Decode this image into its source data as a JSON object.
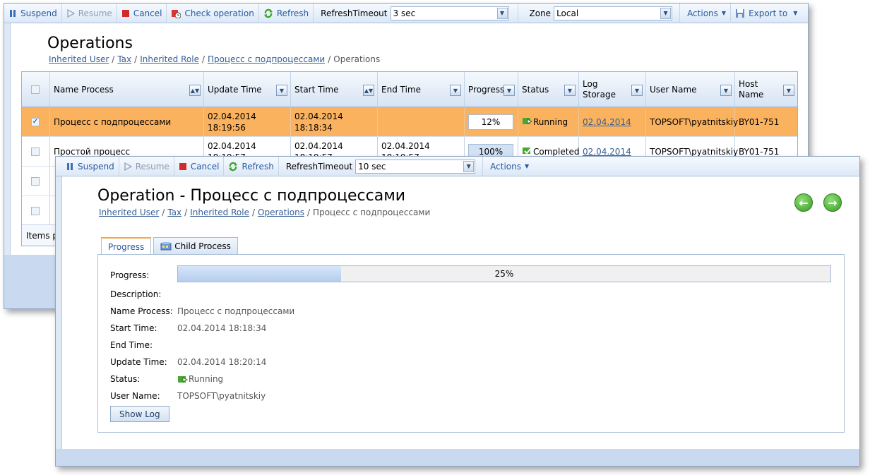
{
  "back_window": {
    "toolbar": {
      "suspend": "Suspend",
      "resume": "Resume",
      "cancel": "Cancel",
      "check_operation": "Check operation",
      "refresh": "Refresh",
      "refresh_timeout_label": "RefreshTimeout",
      "refresh_timeout_value": "3 sec",
      "zone_label": "Zone",
      "zone_value": "Local",
      "actions": "Actions",
      "export_to": "Export to"
    },
    "title": "Operations",
    "breadcrumb": [
      "Inherited User",
      "Tax",
      "Inherited Role",
      "Процесс с подпроцессами"
    ],
    "breadcrumb_current": "Operations",
    "columns": {
      "name": "Name Process",
      "update": "Update Time",
      "start": "Start Time",
      "end": "End Time",
      "progress": "Progress",
      "status": "Status",
      "log_storage_1": "Log",
      "log_storage_2": "Storage",
      "user": "User Name",
      "host_1": "Host",
      "host_2": "Name"
    },
    "rows": [
      {
        "name": "Процесс с подпроцессами",
        "update_date": "02.04.2014",
        "update_time": "18:19:56",
        "start_date": "02.04.2014",
        "start_time": "18:18:34",
        "end_date": "",
        "end_time": "",
        "progress": "12%",
        "status": "Running",
        "log": "02.04.2014",
        "user": "TOPSOFT\\pyatnitskiy",
        "host": "BY01-751"
      },
      {
        "name": "Простой процесс",
        "update_date": "02.04.2014",
        "update_time": "18:19:57",
        "start_date": "02.04.2014",
        "start_time": "18:19:57",
        "end_date": "02.04.2014",
        "end_time": "18:19:57",
        "progress": "100%",
        "status": "Completed",
        "log": "02.04.2014",
        "user": "TOPSOFT\\pyatnitskiy",
        "host": "BY01-751"
      }
    ],
    "footer": "Items p"
  },
  "front_window": {
    "toolbar": {
      "suspend": "Suspend",
      "resume": "Resume",
      "cancel": "Cancel",
      "refresh": "Refresh",
      "refresh_timeout_label": "RefreshTimeout",
      "refresh_timeout_value": "10 sec",
      "actions": "Actions"
    },
    "title": "Operation - Процесс с подпроцессами",
    "breadcrumb": [
      "Inherited User",
      "Tax",
      "Inherited Role",
      "Operations"
    ],
    "breadcrumb_current": "Процесс с подпроцессами",
    "tabs": [
      "Progress",
      "Child Process"
    ],
    "fields": {
      "progress_label": "Progress:",
      "progress_value": "25%",
      "progress_fraction": 0.25,
      "description_label": "Description:",
      "description_value": "",
      "name_label": "Name Process:",
      "name_value": "Процесс с подпроцессами",
      "start_label": "Start Time:",
      "start_value": "02.04.2014 18:18:34",
      "end_label": "End Time:",
      "end_value": "",
      "update_label": "Update Time:",
      "update_value": "02.04.2014 18:20:14",
      "status_label": "Status:",
      "status_value": "Running",
      "user_label": "User Name:",
      "user_value": "TOPSOFT\\pyatnitskiy"
    },
    "show_log": "Show Log"
  },
  "colors": {
    "selected_row": "#fbb25e",
    "link": "#355e95",
    "toolbar_text": "#2a5aa0",
    "status_green": "#3aa02a"
  }
}
